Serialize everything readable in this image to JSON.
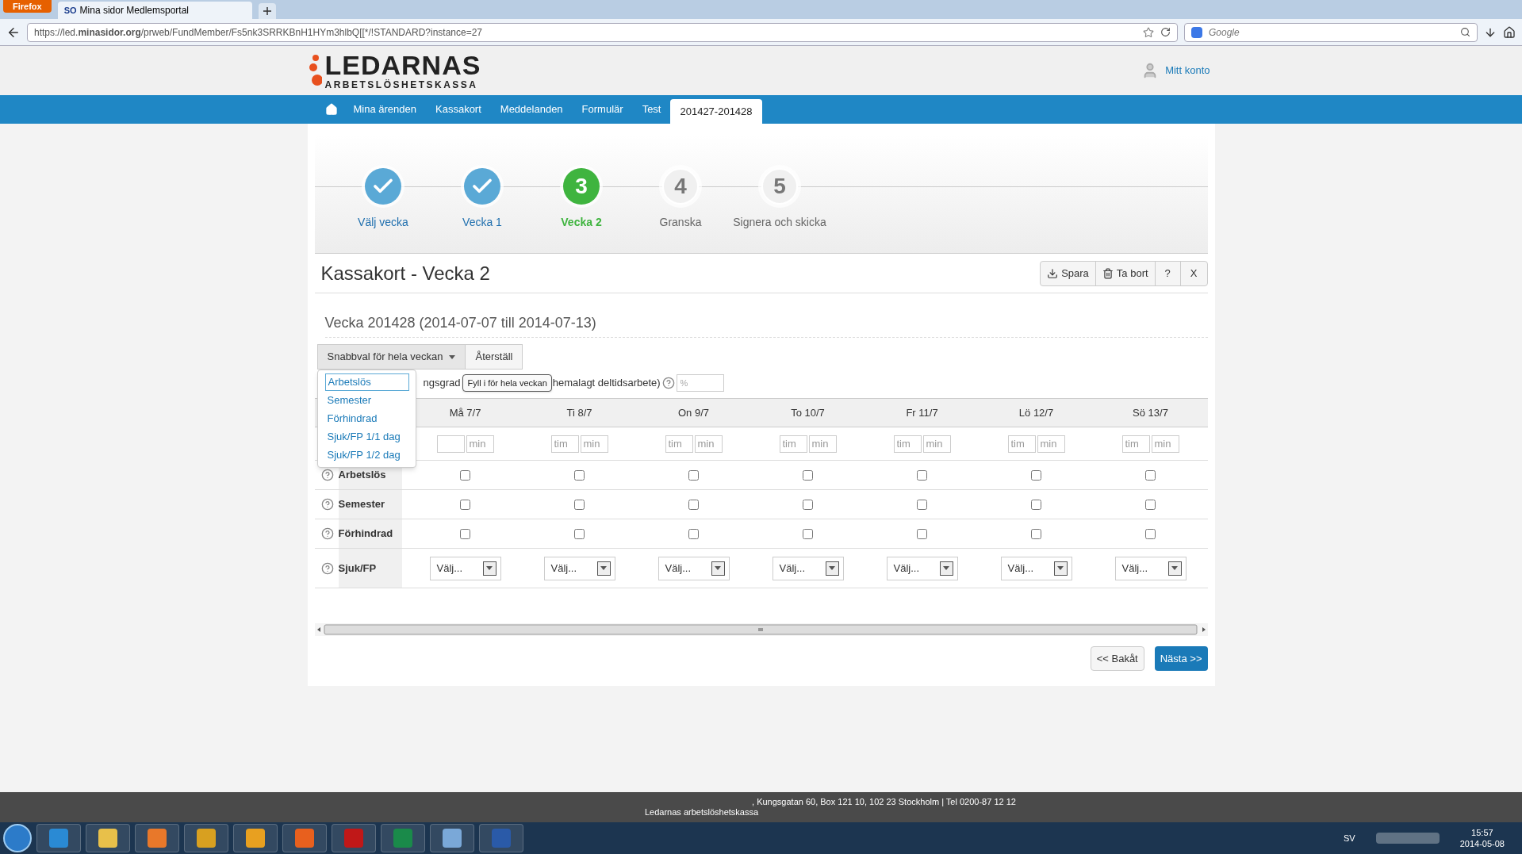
{
  "browser": {
    "menu_button": "Firefox",
    "tab_title": "Mina sidor Medlemsportal",
    "tab_favicon": "SO",
    "url": "https://led.**minasidor.org**/prweb/FundMember/Fs5nk3SRRKBnH1HYm3hlbQ[[*/!STANDARD?instance=27",
    "search_placeholder": "Google"
  },
  "header": {
    "logo_title": "LEDARNAS",
    "logo_subtitle": "ARBETSLÖSHETSKASSA",
    "account": "Mitt konto"
  },
  "nav": [
    {
      "label": "Mina ärenden",
      "selected": false
    },
    {
      "label": "Kassakort",
      "selected": false
    },
    {
      "label": "Meddelanden",
      "selected": false
    },
    {
      "label": "Formulär",
      "selected": false
    },
    {
      "label": "Test",
      "selected": false
    },
    {
      "label": "201427-201428",
      "selected": true
    }
  ],
  "steps": [
    {
      "kind": "done",
      "label": "Välj vecka"
    },
    {
      "kind": "done",
      "label": "Vecka 1"
    },
    {
      "kind": "current",
      "number": "3",
      "label": "Vecka 2"
    },
    {
      "kind": "todo",
      "number": "4",
      "label": "Granska"
    },
    {
      "kind": "todo",
      "number": "5",
      "label": "Signera och skicka"
    }
  ],
  "title": "Kassakort - Vecka 2",
  "toolbar": {
    "save": "Spara",
    "delete": "Ta bort",
    "help": "?",
    "close": "X"
  },
  "week_heading": "Vecka 201428 (2014-07-07 till 2014-07-13)",
  "quick_select": {
    "label": "Snabbval för hela veckan",
    "reset": "Återställ",
    "expanded": true,
    "options": [
      {
        "label": "Arbetslös",
        "selected": true
      },
      {
        "label": "Semester",
        "selected": false
      },
      {
        "label": "Förhindrad",
        "selected": false
      },
      {
        "label": "Sjuk/FP 1/1 dag",
        "selected": false
      },
      {
        "label": "Sjuk/FP 1/2 dag",
        "selected": false
      }
    ],
    "tooltip": "Fyll i för hela veckan"
  },
  "percent_row": {
    "label_start": "ngsgrad",
    "label_end": "hemalagt deltidsarbete)",
    "placeholder": "%"
  },
  "days": [
    {
      "label": "Må 7/7",
      "minutes": {
        "placeholder": "min"
      }
    },
    {
      "label": "Ti 8/7",
      "hours": {
        "placeholder": "tim"
      },
      "minutes": {
        "placeholder": "min"
      }
    },
    {
      "label": "On 9/7",
      "hours": {
        "placeholder": "tim"
      },
      "minutes": {
        "placeholder": "min"
      }
    },
    {
      "label": "To 10/7",
      "hours": {
        "placeholder": "tim"
      },
      "minutes": {
        "placeholder": "min"
      }
    },
    {
      "label": "Fr 11/7",
      "hours": {
        "placeholder": "tim"
      },
      "minutes": {
        "placeholder": "min"
      }
    },
    {
      "label": "Lö 12/7",
      "hours": {
        "placeholder": "tim"
      },
      "minutes": {
        "placeholder": "min"
      }
    },
    {
      "label": "Sö 13/7",
      "hours": {
        "placeholder": "tim"
      },
      "minutes": {
        "placeholder": "min"
      }
    }
  ],
  "rows": [
    {
      "kind": "checkbox",
      "label": "Arbetslös",
      "checked": [
        false,
        false,
        false,
        false,
        false,
        false,
        false
      ]
    },
    {
      "kind": "checkbox",
      "label": "Semester",
      "checked": [
        false,
        false,
        false,
        false,
        false,
        false,
        false
      ]
    },
    {
      "kind": "checkbox",
      "label": "Förhindrad",
      "checked": [
        false,
        false,
        false,
        false,
        false,
        false,
        false
      ]
    },
    {
      "kind": "select",
      "label": "Sjuk/FP",
      "values": [
        "Välj...",
        "Välj...",
        "Välj...",
        "Välj...",
        "Välj...",
        "Välj...",
        "Välj..."
      ]
    }
  ],
  "buttons": {
    "back": "<< Bakåt",
    "next": "Nästa >>"
  },
  "footer": {
    "address": ", Kungsgatan 60, Box 121 10, 102 23 Stockholm | Tel 0200-87 12 12",
    "name": "Ledarnas arbetslöshetskassa"
  },
  "tray": {
    "language": "SV",
    "time": "15:57",
    "date": "2014-05-08"
  }
}
